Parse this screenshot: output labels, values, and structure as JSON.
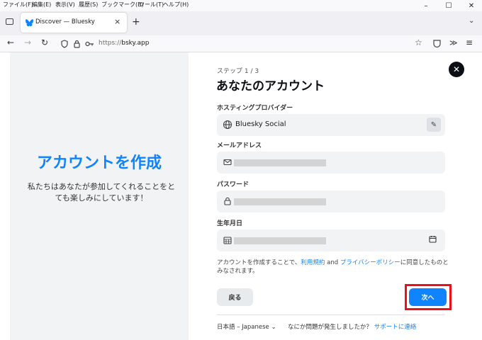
{
  "menubar": {
    "items": [
      "ファイル(F)",
      "編集(E)",
      "表示(V)",
      "履歴(S)",
      "ブックマーク(B)",
      "ツール(T)",
      "ヘルプ(H)"
    ]
  },
  "window_controls": {
    "minimize": "–",
    "maximize": "☐",
    "close": "✕"
  },
  "tab": {
    "title": "Discover — Bluesky",
    "icon": "butterfly-icon"
  },
  "navbar": {
    "url_scheme": "https://",
    "url_host": "bsky.app"
  },
  "left_panel": {
    "title": "アカウントを作成",
    "subtitle": "私たちはあなたが参加してくれることをとても楽しみにしています！"
  },
  "form": {
    "step": "ステップ 1 / 3",
    "title": "あなたのアカウント",
    "hosting_label": "ホスティングプロバイダー",
    "hosting_value": "Bluesky Social",
    "email_label": "メールアドレス",
    "password_label": "パスワード",
    "birthday_label": "生年月日",
    "terms_prefix": "アカウントを作成することで、",
    "terms_link": "利用規約",
    "terms_and": " and ",
    "privacy_link": "プライバシーポリシー",
    "terms_suffix": "に同意したものとみなされます。",
    "back_label": "戻る",
    "next_label": "次へ"
  },
  "footer": {
    "language": "日本語 – Japanese",
    "help_text": "なにか問題が発生しましたか？",
    "support_link": "サポートに連絡"
  },
  "colors": {
    "accent": "#1083fe",
    "highlight": "#e8121d"
  }
}
